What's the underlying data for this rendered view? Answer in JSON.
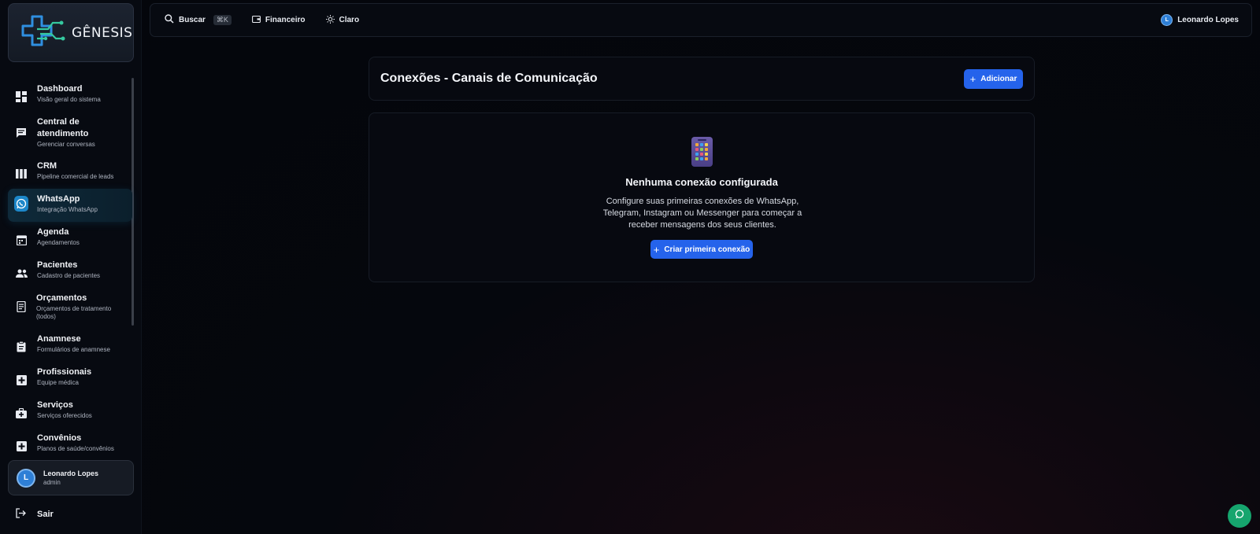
{
  "brand": {
    "name": "GÊNESIS"
  },
  "sidebar": {
    "items": [
      {
        "icon": "dashboard-icon",
        "label": "Dashboard",
        "sub": "Visão geral do sistema"
      },
      {
        "icon": "chat-icon",
        "label": "Central de atendimento",
        "sub": "Gerenciar conversas"
      },
      {
        "icon": "kanban-icon",
        "label": "CRM",
        "sub": "Pipeline comercial de leads"
      },
      {
        "icon": "whatsapp-icon",
        "label": "WhatsApp",
        "sub": "Integração WhatsApp",
        "active": true
      },
      {
        "icon": "calendar-icon",
        "label": "Agenda",
        "sub": "Agendamentos"
      },
      {
        "icon": "people-icon",
        "label": "Pacientes",
        "sub": "Cadastro de pacientes"
      },
      {
        "icon": "receipt-icon",
        "label": "Orçamentos",
        "sub": "Orçamentos de tratamento (todos)"
      },
      {
        "icon": "clipboard-icon",
        "label": "Anamnese",
        "sub": "Formulários de anamnese"
      },
      {
        "icon": "medical-plus-icon",
        "label": "Profissionais",
        "sub": "Equipe médica"
      },
      {
        "icon": "medical-bag-icon",
        "label": "Serviços",
        "sub": "Serviços oferecidos"
      },
      {
        "icon": "medical-plus-icon",
        "label": "Convênios",
        "sub": "Planos de saúde/convênios"
      }
    ],
    "user": {
      "initial": "L",
      "name": "Leonardo Lopes",
      "role": "admin"
    },
    "logout_label": "Sair"
  },
  "topbar": {
    "search_label": "Buscar",
    "search_shortcut": "⌘K",
    "finance_label": "Financeiro",
    "theme_label": "Claro",
    "user_initial": "L",
    "user_name": "Leonardo Lopes"
  },
  "main": {
    "title": "Conexões - Canais de Comunicação",
    "add_label": "Adicionar",
    "empty": {
      "title": "Nenhuma conexão configurada",
      "description": "Configure suas primeiras conexões de WhatsApp, Telegram, Instagram ou Messenger para começar a receber mensagens dos seus clientes.",
      "cta_label": "Criar primeira conexão"
    }
  },
  "colors": {
    "accent": "#2563eb",
    "active_bg": "#0f2a3a",
    "fab": "#16a56e"
  }
}
